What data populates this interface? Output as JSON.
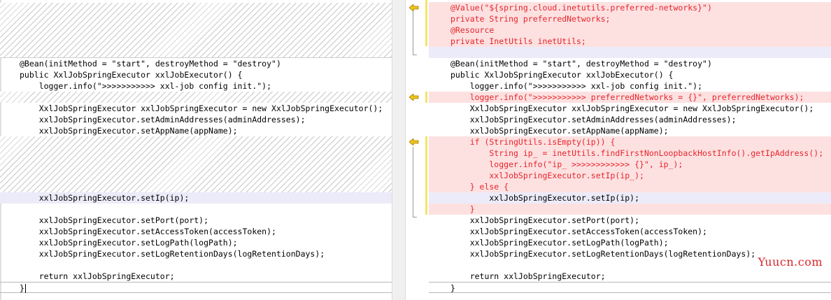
{
  "left_pane": {
    "lines": [
      "",
      "",
      "",
      "",
      "",
      "@Bean(initMethod = \"start\", destroyMethod = \"destroy\")",
      "public XxlJobSpringExecutor xxlJobExecutor() {",
      "    logger.info(\">>>>>>>>>>> xxl-job config init.\");",
      "",
      "    XxlJobSpringExecutor xxlJobSpringExecutor = new XxlJobSpringExecutor();",
      "    xxlJobSpringExecutor.setAdminAddresses(adminAddresses);",
      "    xxlJobSpringExecutor.setAppName(appName);",
      "",
      "",
      "",
      "",
      "",
      "    xxlJobSpringExecutor.setIp(ip);",
      "",
      "    xxlJobSpringExecutor.setPort(port);",
      "    xxlJobSpringExecutor.setAccessToken(accessToken);",
      "    xxlJobSpringExecutor.setLogPath(logPath);",
      "    xxlJobSpringExecutor.setLogRetentionDays(logRetentionDays);",
      "",
      "    return xxlJobSpringExecutor;",
      "}"
    ]
  },
  "right_pane": {
    "lines": [
      "@Value(\"${spring.cloud.inetutils.preferred-networks}\")",
      "private String preferredNetworks;",
      "@Resource",
      "private InetUtils inetUtils;",
      "",
      "@Bean(initMethod = \"start\", destroyMethod = \"destroy\")",
      "public XxlJobSpringExecutor xxlJobExecutor() {",
      "    logger.info(\">>>>>>>>>>> xxl-job config init.\");",
      "    logger.info(\">>>>>>>>>>> preferredNetworks = {}\", preferredNetworks);",
      "    XxlJobSpringExecutor xxlJobSpringExecutor = new XxlJobSpringExecutor();",
      "    xxlJobSpringExecutor.setAdminAddresses(adminAddresses);",
      "    xxlJobSpringExecutor.setAppName(appName);",
      "    if (StringUtils.isEmpty(ip)) {",
      "        String ip_ = inetUtils.findFirstNonLoopbackHostInfo().getIpAddress();",
      "        logger.info(\"ip_ >>>>>>>>>>>> {}\", ip_);",
      "        xxlJobSpringExecutor.setIp(ip_);",
      "    } else {",
      "        xxlJobSpringExecutor.setIp(ip);",
      "    }",
      "    xxlJobSpringExecutor.setPort(port);",
      "    xxlJobSpringExecutor.setAccessToken(accessToken);",
      "    xxlJobSpringExecutor.setLogPath(logPath);",
      "    xxlJobSpringExecutor.setLogRetentionDays(logRetentionDays);",
      "",
      "    return xxlJobSpringExecutor;",
      "}"
    ]
  },
  "watermark": "Yuucn.com",
  "colors": {
    "added_bg": "#fde1e1",
    "added_text": "#e8242b",
    "modified_bg": "#ecebf9",
    "gutter_bar": "#f5e36a",
    "merge_arrow": "#f0c419"
  },
  "icons": {
    "merge_arrow": "arrow-left-icon"
  }
}
